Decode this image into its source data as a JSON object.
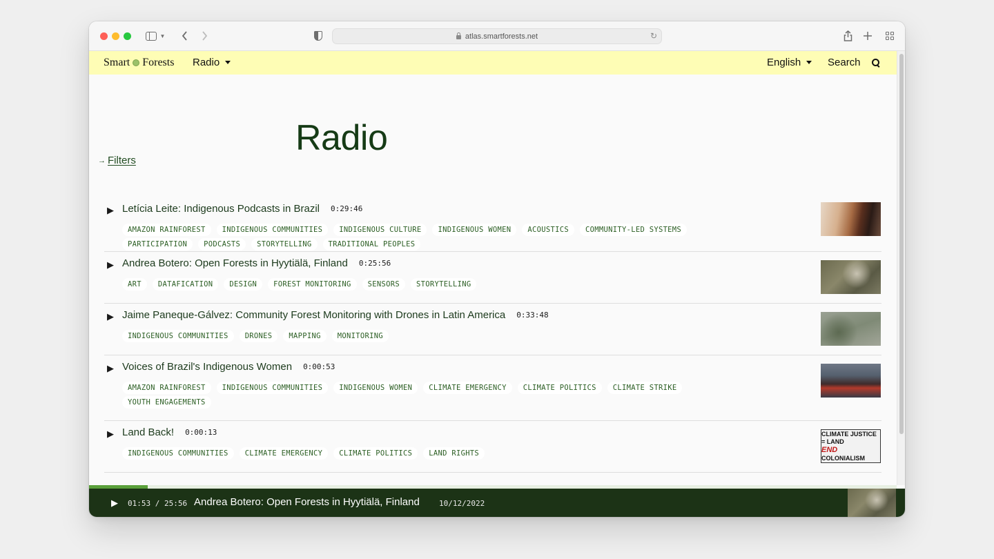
{
  "browser": {
    "url": "atlas.smartforests.net"
  },
  "site": {
    "logo_left": "Smart",
    "logo_right": "Forests",
    "nav_radio": "Radio",
    "language": "English",
    "search": "Search"
  },
  "page": {
    "title": "Radio",
    "filters": "Filters"
  },
  "episodes": [
    {
      "title": "Letícia Leite: Indigenous Podcasts in Brazil",
      "duration": "0:29:46",
      "tags": [
        "AMAZON RAINFOREST",
        "INDIGENOUS COMMUNITIES",
        "INDIGENOUS CULTURE",
        "INDIGENOUS WOMEN",
        "ACOUSTICS",
        "COMMUNITY-LED SYSTEMS",
        "PARTICIPATION",
        "PODCASTS",
        "STORYTELLING",
        "TRADITIONAL PEOPLES"
      ]
    },
    {
      "title": "Andrea Botero: Open Forests in Hyytiälä, Finland",
      "duration": "0:25:56",
      "tags": [
        "ART",
        "DATAFICATION",
        "DESIGN",
        "FOREST MONITORING",
        "SENSORS",
        "STORYTELLING"
      ]
    },
    {
      "title": "Jaime Paneque-Gálvez: Community Forest Monitoring with Drones in Latin America",
      "duration": "0:33:48",
      "tags": [
        "INDIGENOUS COMMUNITIES",
        "DRONES",
        "MAPPING",
        "MONITORING"
      ]
    },
    {
      "title": "Voices of Brazil's Indigenous Women",
      "duration": "0:00:53",
      "tags": [
        "AMAZON RAINFOREST",
        "INDIGENOUS COMMUNITIES",
        "INDIGENOUS WOMEN",
        "CLIMATE EMERGENCY",
        "CLIMATE POLITICS",
        "CLIMATE STRIKE",
        "YOUTH ENGAGEMENTS"
      ]
    },
    {
      "title": "Land Back!",
      "duration": "0:00:13",
      "tags": [
        "INDIGENOUS COMMUNITIES",
        "CLIMATE EMERGENCY",
        "CLIMATE POLITICS",
        "LAND RIGHTS"
      ]
    }
  ],
  "thumb_text": {
    "line1": "CLIMATE JUSTICE = LAND",
    "line2a": "END",
    "line2b": "COLONIALISM"
  },
  "player": {
    "time": "01:53 / 25:56",
    "title": "Andrea Botero: Open Forests in Hyytiälä, Finland",
    "date": "10/12/2022",
    "progress": 0.073
  },
  "colors": {
    "header_bg": "#fefdb5",
    "title_green": "#163b16",
    "tag_green": "#2b5e23",
    "player_bg": "#1c3316",
    "progress_green": "#5aa03a"
  }
}
